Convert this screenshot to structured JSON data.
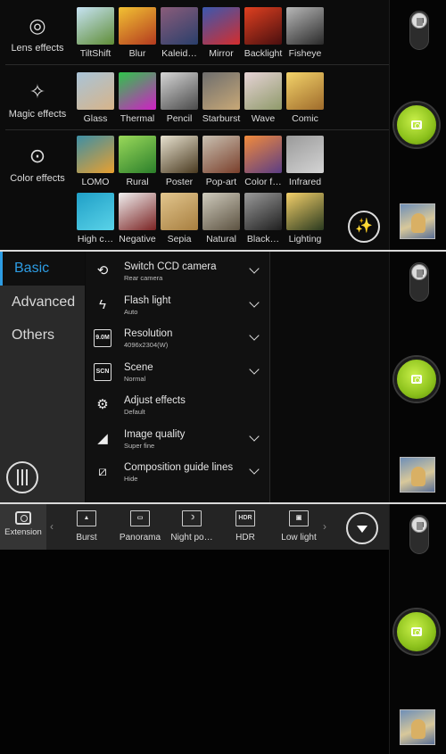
{
  "effects_panel": {
    "categories": [
      {
        "label": "Lens effects",
        "icon": "lens-icon"
      },
      {
        "label": "Magic effects",
        "icon": "magic-icon"
      },
      {
        "label": "Color effects",
        "icon": "color-circles-icon"
      }
    ],
    "rows": [
      [
        {
          "label": "TiltShift",
          "color_a": "#c7e3f4",
          "color_b": "#5f8d36"
        },
        {
          "label": "Blur",
          "color_a": "#f2c233",
          "color_b": "#b33a1f"
        },
        {
          "label": "Kaleid…",
          "color_a": "#8a5c7a",
          "color_b": "#2a3f6b"
        },
        {
          "label": "Mirror",
          "color_a": "#3a58b0",
          "color_b": "#d42d2d"
        },
        {
          "label": "Backlight",
          "color_a": "#e04020",
          "color_b": "#4a0f0f"
        },
        {
          "label": "Fisheye",
          "color_a": "#b8b8b8",
          "color_b": "#2a2a2a"
        }
      ],
      [
        {
          "label": "Glass",
          "color_a": "#a9c4d8",
          "color_b": "#d7b489"
        },
        {
          "label": "Thermal",
          "color_a": "#2ec54a",
          "color_b": "#d11fc6"
        },
        {
          "label": "Pencil",
          "color_a": "#d6d6d6",
          "color_b": "#4a4a4a"
        },
        {
          "label": "Starburst",
          "color_a": "#6e6e6e",
          "color_b": "#c8a877"
        },
        {
          "label": "Wave",
          "color_a": "#e6d3d6",
          "color_b": "#8f9a6a"
        },
        {
          "label": "Comic",
          "color_a": "#f3d36a",
          "color_b": "#9f6b2b"
        }
      ],
      [
        {
          "label": "LOMO",
          "color_a": "#3d8fa5",
          "color_b": "#e9a02f"
        },
        {
          "label": "Rural",
          "color_a": "#9ad95a",
          "color_b": "#2b7f2b"
        },
        {
          "label": "Poster",
          "color_a": "#e8e2d0",
          "color_b": "#4a3a20"
        },
        {
          "label": "Pop-art",
          "color_a": "#c9c1b2",
          "color_b": "#7a3f2b"
        },
        {
          "label": "Color f…",
          "color_a": "#f28b3c",
          "color_b": "#5b3d85"
        },
        {
          "label": "Infrared",
          "color_a": "#9a9a9a",
          "color_b": "#d4d4d4"
        }
      ],
      [
        {
          "label": "High c…",
          "color_a": "#1f9fc7",
          "color_b": "#5ad3e8"
        },
        {
          "label": "Negative",
          "color_a": "#f0f0f0",
          "color_b": "#7a2222"
        },
        {
          "label": "Sepia",
          "color_a": "#e2c68e",
          "color_b": "#a77e3f"
        },
        {
          "label": "Natural",
          "color_a": "#cfcbbd",
          "color_b": "#5c5241"
        },
        {
          "label": "Black…",
          "color_a": "#9a9a9a",
          "color_b": "#1f1f1f"
        },
        {
          "label": "Lighting",
          "color_a": "#f4d06a",
          "color_b": "#2a3a1f"
        }
      ]
    ]
  },
  "settings_panel": {
    "tabs": [
      {
        "label": "Basic",
        "active": true
      },
      {
        "label": "Advanced",
        "active": false
      },
      {
        "label": "Others",
        "active": false
      }
    ],
    "items": [
      {
        "title": "Switch CCD camera",
        "subtitle": "Rear camera",
        "icon": "switch-camera-icon",
        "glyph": "⟲",
        "has_dropdown": true
      },
      {
        "title": "Flash light",
        "subtitle": "Auto",
        "icon": "flash-auto-icon",
        "glyph": "ϟ",
        "has_dropdown": true
      },
      {
        "title": "Resolution",
        "subtitle": "4096x2304(W)",
        "icon": "resolution-icon",
        "glyph": "9.0M",
        "has_dropdown": true
      },
      {
        "title": "Scene",
        "subtitle": "Normal",
        "icon": "scene-icon",
        "glyph": "SCN",
        "has_dropdown": true
      },
      {
        "title": "Adjust effects",
        "subtitle": "Default",
        "icon": "adjust-effects-icon",
        "glyph": "⚙",
        "has_dropdown": false
      },
      {
        "title": "Image quality",
        "subtitle": "Super fine",
        "icon": "image-quality-icon",
        "glyph": "◢",
        "has_dropdown": true
      },
      {
        "title": "Composition guide lines",
        "subtitle": "Hide",
        "icon": "composition-guide-icon",
        "glyph": "⧄",
        "has_dropdown": true
      }
    ]
  },
  "extension_panel": {
    "extension_label": "Extension",
    "modes": [
      {
        "label": "Burst",
        "icon": "burst-icon",
        "glyph": "▲"
      },
      {
        "label": "Panorama",
        "icon": "panorama-icon",
        "glyph": "▭"
      },
      {
        "label": "Night po…",
        "icon": "night-portrait-icon",
        "glyph": "☽"
      },
      {
        "label": "HDR",
        "icon": "hdr-icon",
        "glyph": "HDR"
      },
      {
        "label": "Low light",
        "icon": "low-light-icon",
        "glyph": "▣"
      }
    ]
  },
  "colors": {
    "accent_blue": "#2d9ce3",
    "shutter_green": "#8cc11c",
    "panel_gray": "#2a2a2a"
  }
}
